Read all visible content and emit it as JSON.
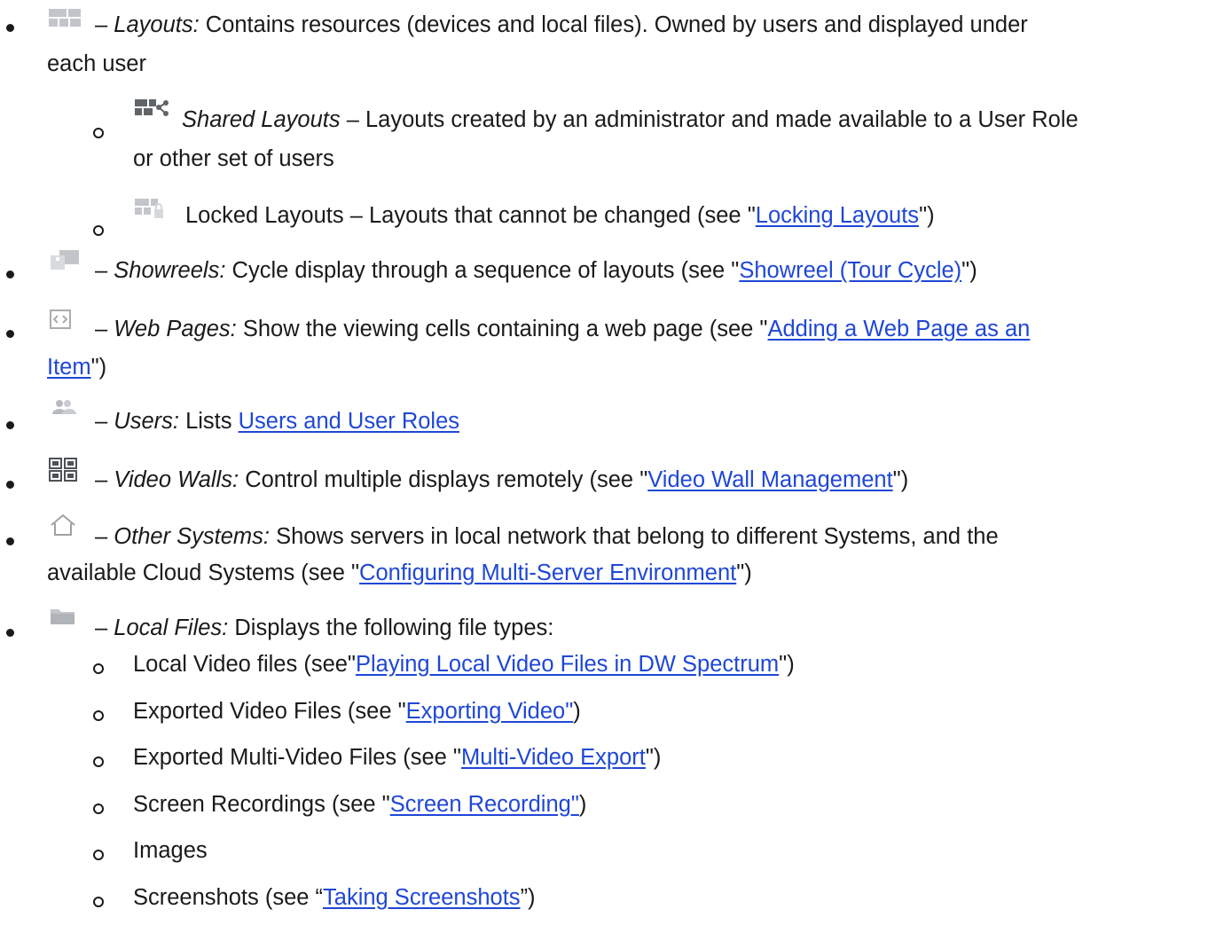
{
  "items": {
    "layouts": {
      "icon": "layouts-icon",
      "dash": "–",
      "term": "Layouts:",
      "text": "Contains resources (devices and local files). Owned by users and displayed under",
      "text2": "each user"
    },
    "shared_layouts": {
      "icon": "shared-layouts-icon",
      "term": "Shared Layouts",
      "text": "– Layouts created by an administrator and made available to a User Role",
      "text2": "or other set of users"
    },
    "locked_layouts": {
      "icon": "locked-layouts-icon",
      "text_before": "Locked Layouts – Layouts that cannot be changed (see \"",
      "link": "Locking Layouts",
      "text_after": "\")"
    },
    "showreels": {
      "icon": "showreels-icon",
      "dash": "–",
      "term": "Showreels:",
      "text_before": "Cycle display through a sequence of layouts (see \"",
      "link": "Showreel (Tour Cycle)",
      "text_after": "\")"
    },
    "web_pages": {
      "icon": "web-page-icon",
      "dash": "–",
      "term": "Web Pages:",
      "text_before": "Show the viewing cells containing a web page (see \"",
      "link": "Adding a Web Page as an ",
      "link2": "Item",
      "text_after": "\")"
    },
    "users": {
      "icon": "users-icon",
      "dash": "–",
      "term": "Users:",
      "text_before": "Lists ",
      "link": "Users and User Roles"
    },
    "video_walls": {
      "icon": "video-wall-icon",
      "dash": "–",
      "term": "Video Walls:",
      "text_before": "Control multiple displays remotely (see \"",
      "link": "Video Wall Management",
      "text_after": "\")"
    },
    "other_systems": {
      "icon": "home-icon",
      "dash": "–",
      "term": "Other Systems:",
      "text": "Shows servers in local network that belong to different Systems, and the",
      "text2_before": "available Cloud Systems (see \"",
      "link": "Configuring Multi-Server Environment",
      "text2_after": "\")"
    },
    "local_files": {
      "icon": "folder-icon",
      "dash": "–",
      "term": "Local Files:",
      "text": "Displays the following file types:",
      "subitems": [
        {
          "before": "Local Video files (see\"",
          "link": "Playing Local Video Files in DW Spectrum",
          "after": "\")"
        },
        {
          "before": "Exported Video Files (see \"",
          "link": "Exporting Video\"",
          "after": ")"
        },
        {
          "before": "Exported Multi-Video Files (see \"",
          "link": "Multi-Video Export",
          "after": "\")"
        },
        {
          "before": "Screen Recordings (see \"",
          "link": "Screen Recording\"",
          "after": ")"
        },
        {
          "before": "Images",
          "link": "",
          "after": ""
        },
        {
          "before": "Screenshots (see “",
          "link": "Taking Screenshots",
          "after": "”)"
        }
      ]
    }
  },
  "colors": {
    "text": "#1a1a1a",
    "link": "#1f47d6",
    "icon_gray": "#b8bcc0",
    "icon_dark": "#5f6468"
  }
}
